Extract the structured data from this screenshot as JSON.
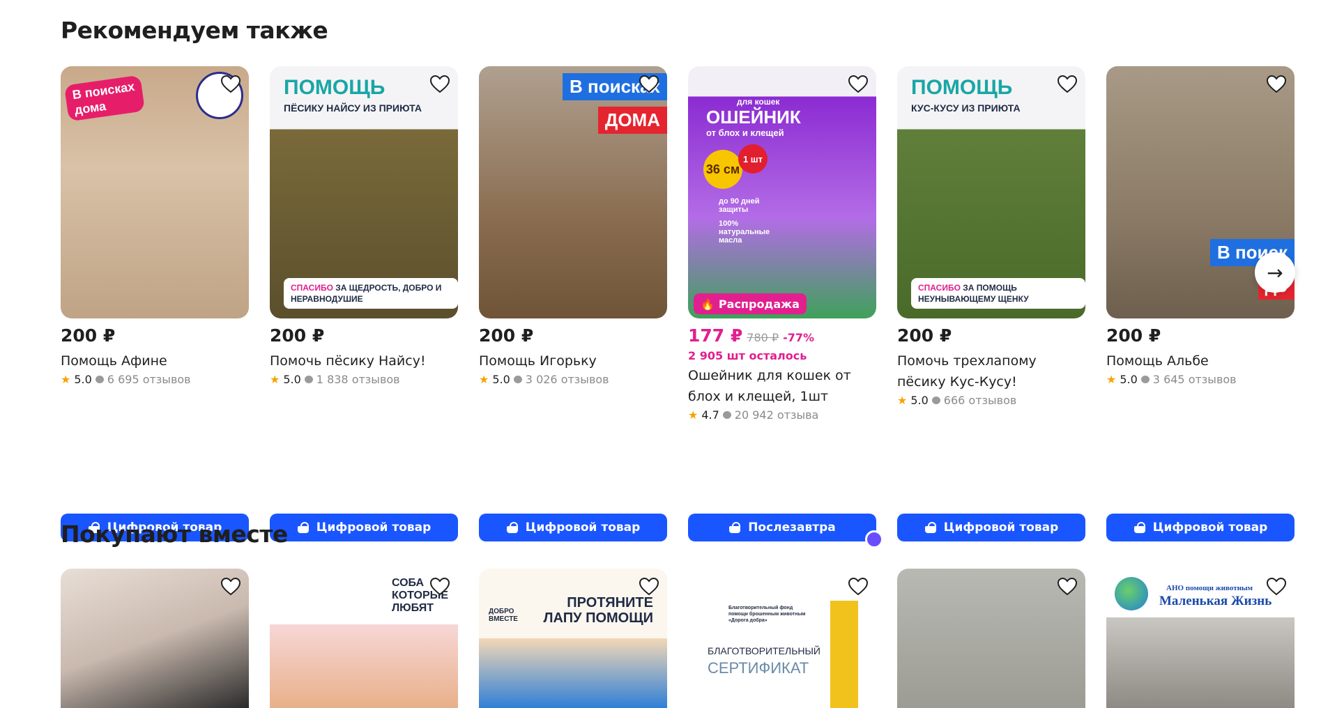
{
  "sections": {
    "recommended_title": "Рекомендуем также",
    "bought_together_title": "Покупают вместе"
  },
  "recommended": [
    {
      "price": "200 ₽",
      "title": "Помощь Афине",
      "rating": "5.0",
      "reviews": "6 695 отзывов",
      "button": "Цифровой товар",
      "image_text": [
        "В поисках",
        "дома"
      ]
    },
    {
      "price": "200 ₽",
      "title": "Помочь пёсику Найсу!",
      "rating": "5.0",
      "reviews": "1 838 отзывов",
      "button": "Цифровой товар",
      "image_text": [
        "ПОМОЩЬ",
        "ПЁСИКУ НАЙСУ ИЗ ПРИЮТА",
        "СПАСИБО",
        "ЗА ЩЕДРОСТЬ, ДОБРО И НЕРАВНОДУШИЕ"
      ]
    },
    {
      "price": "200 ₽",
      "title": "Помощь Игорьку",
      "rating": "5.0",
      "reviews": "3 026 отзывов",
      "button": "Цифровой товар",
      "image_text": [
        "В поисках",
        "ДОМА"
      ]
    },
    {
      "price": "177 ₽",
      "old_price": "780 ₽",
      "discount": "-77%",
      "stock": "2 905 шт осталось",
      "title": "Ошейник для кошек от блох и клещей, 1шт",
      "rating": "4.7",
      "reviews": "20 942 отзыва",
      "button": "Послезавтра",
      "badge": "Распродажа",
      "image_text": [
        "для кошек",
        "ОШЕЙНИК",
        "от блох и клещей",
        "36 см",
        "1 шт",
        "до 90 дней защиты",
        "100% натуральные масла"
      ]
    },
    {
      "price": "200 ₽",
      "title": "Помочь трехлапому пёсику Кус-Кусу!",
      "rating": "5.0",
      "reviews": "666 отзывов",
      "button": "Цифровой товар",
      "image_text": [
        "ПОМОЩЬ",
        "КУС-КУСУ ИЗ ПРИЮТА",
        "СПАСИБО",
        "ЗА ПОМОЩЬ НЕУНЫВАЮЩЕМУ ЩЕНКУ"
      ]
    },
    {
      "price": "200 ₽",
      "title": "Помощь Альбе",
      "rating": "5.0",
      "reviews": "3 645 отзывов",
      "button": "Цифровой товар",
      "image_text": [
        "В поиск",
        "до"
      ]
    }
  ],
  "bought_together": [
    {
      "image_text": []
    },
    {
      "image_text": [
        "СОБА",
        "КОТОРЫЕ",
        "ЛЮБЯТ"
      ]
    },
    {
      "image_text": [
        "ДОБРО ВМЕСТЕ",
        "ПРОТЯНИТЕ",
        "ЛАПУ ПОМОЩИ"
      ]
    },
    {
      "image_text": [
        "Благотворительный фонд помощи брошенным животным «Дорога добра»",
        "БЛАГОТВОРИТЕЛЬНЫЙ",
        "СЕРТИФИКАТ"
      ]
    },
    {
      "image_text": []
    },
    {
      "image_text": [
        "АНО помощи животным",
        "Маленькая Жизнь"
      ]
    }
  ],
  "icons": {
    "favorite": "heart-icon",
    "next": "arrow-right-icon",
    "button": "basket-icon",
    "badge": "fire-icon",
    "rating": "star-icon",
    "reviews": "chat-bubble-icon"
  },
  "colors": {
    "accent_blue": "#1a56ff",
    "sale_pink": "#e11f8f",
    "star": "#f5a300"
  }
}
